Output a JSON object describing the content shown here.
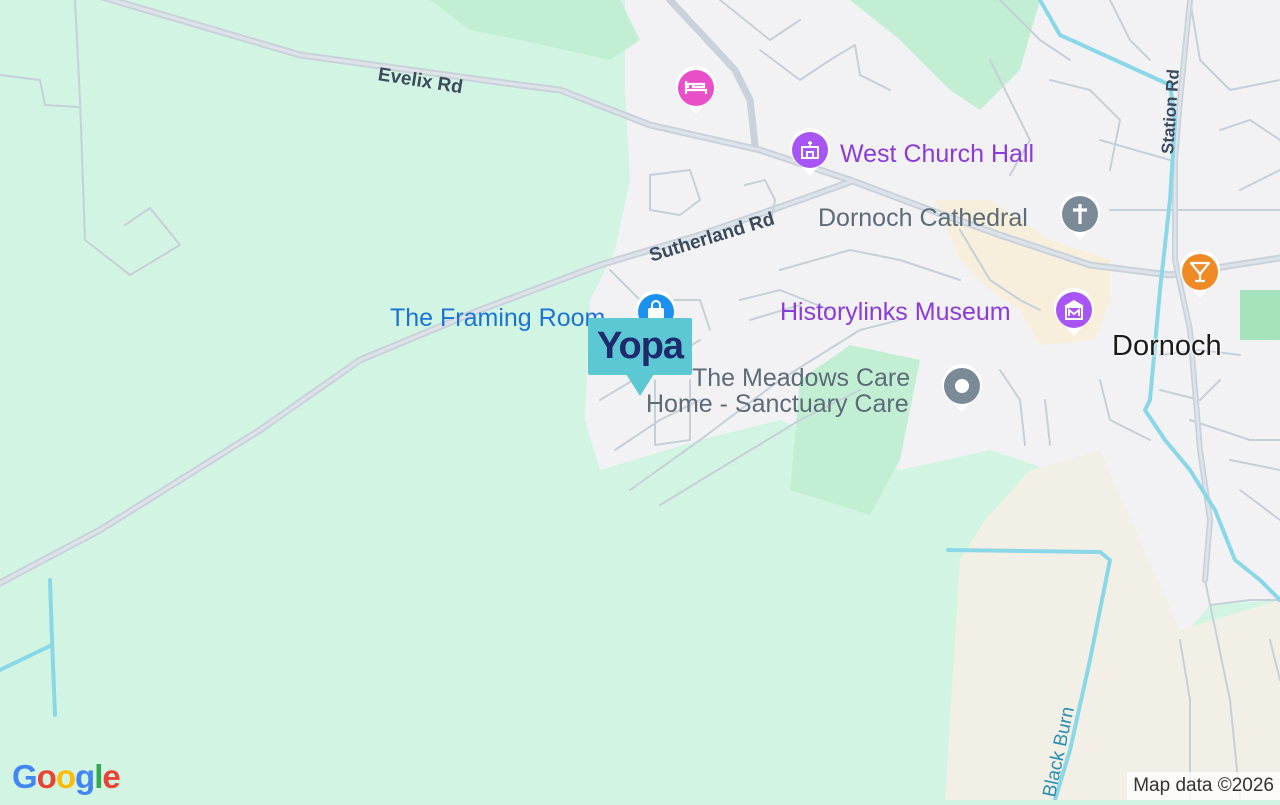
{
  "map": {
    "roads": {
      "evelix": "Evelix Rd",
      "sutherland": "Sutherland Rd",
      "station": "Station Rd",
      "black_burn": "Black Burn"
    },
    "places": {
      "dornoch": "Dornoch"
    },
    "pois": {
      "hotel": {
        "label": "",
        "icon": "bed-icon",
        "color": "#e94fc8"
      },
      "west_church_hall": {
        "label": "West Church Hall",
        "icon": "hall-icon",
        "color": "#a855f7"
      },
      "dornoch_cathedral": {
        "label": "Dornoch Cathedral",
        "icon": "cross-icon",
        "color": "#7b8a97"
      },
      "bar": {
        "label": "",
        "icon": "cocktail-icon",
        "color": "#f08a24"
      },
      "framing_room": {
        "label": "The Framing Room",
        "icon": "shopping-bag-icon",
        "color": "#1a90f0"
      },
      "historylinks": {
        "label": "Historylinks Museum",
        "icon": "museum-icon",
        "color": "#a855f7"
      },
      "meadows": {
        "label_line1": "The Meadows Care",
        "label_line2": "Home - Sanctuary Care",
        "icon": "place-dot-icon",
        "color": "#7b8a97"
      }
    },
    "brand_marker": {
      "text": "Yopa",
      "color": "#5bc8d4",
      "text_color": "#1d2a6b"
    },
    "google_logo": [
      "G",
      "o",
      "o",
      "g",
      "l",
      "e"
    ],
    "attribution": "Map data ©2026"
  }
}
